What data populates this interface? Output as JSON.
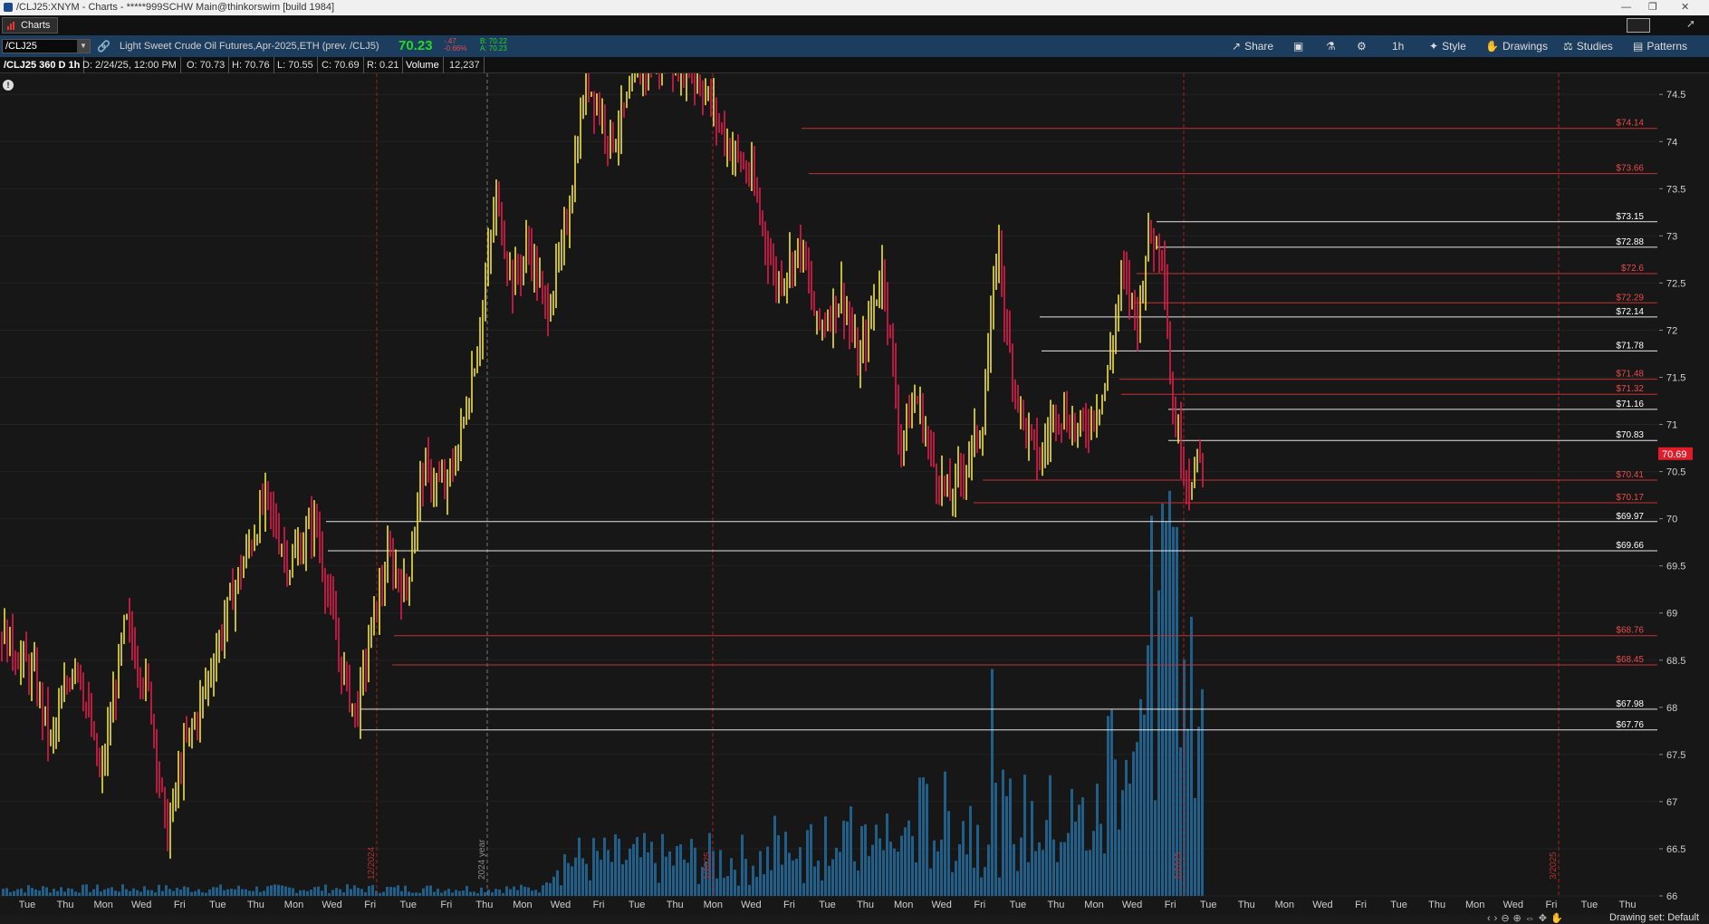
{
  "window": {
    "title": "/CLJ25:XNYM - Charts - *****999SCHW Main@thinkorswim [build 1984]"
  },
  "tab": {
    "label": "Charts"
  },
  "symbol": {
    "value": "/CLJ25",
    "description": "Light Sweet Crude Oil Futures,Apr-2025,ETH (prev. /CLJ5)",
    "last": "70.23",
    "change": "-.47",
    "change_pct": "-0.66%",
    "bid": "B: 70.22",
    "ask": "A: 70.23"
  },
  "toolbar": {
    "share": "Share",
    "timeframe": "1h",
    "style": "Style",
    "drawings": "Drawings",
    "studies": "Studies",
    "patterns": "Patterns"
  },
  "infobar": {
    "aggregation": "/CLJ25 360 D 1h",
    "date": "D: 2/24/25, 12:00 PM",
    "open": "O: 70.73",
    "high": "H: 70.76",
    "low": "L: 70.55",
    "close": "C: 70.69",
    "range": "R: 0.21",
    "volume_label": "Volume",
    "volume_value": "12,237"
  },
  "footer": {
    "drawing_set": "Drawing set: Default"
  },
  "chart_data": {
    "type": "ohlc",
    "current_price": "70.69",
    "y_axis_ticks": [
      "74.5",
      "74",
      "73.5",
      "73",
      "72.5",
      "72",
      "71.5",
      "71",
      "70.5",
      "70",
      "69.5",
      "69",
      "68.5",
      "68",
      "67.5",
      "67",
      "66.5",
      "66"
    ],
    "ylim": [
      66,
      74.8
    ],
    "x_axis_labels": [
      "Tue",
      "Thu",
      "Mon",
      "Wed",
      "Fri",
      "Tue",
      "Thu",
      "Mon",
      "Wed",
      "Fri",
      "Tue",
      "Fri",
      "Thu",
      "Mon",
      "Wed",
      "Fri",
      "Tue",
      "Thu",
      "Mon",
      "Wed",
      "Fri",
      "Tue",
      "Thu",
      "Mon",
      "Wed",
      "Fri",
      "Tue",
      "Thu",
      "Mon",
      "Wed",
      "Fri",
      "Tue",
      "Thu",
      "Mon",
      "Wed",
      "Fri",
      "Tue",
      "Thu",
      "Mon",
      "Wed",
      "Fri",
      "Tue",
      "Thu"
    ],
    "period_markers": [
      "12/2024",
      "2024 year",
      "1/2025",
      "2/2025",
      "3/2025"
    ],
    "levels": [
      {
        "label": "$74.14",
        "value": 74.14,
        "color": "#e84a4a"
      },
      {
        "label": "$73.66",
        "value": 73.66,
        "color": "#e84a4a"
      },
      {
        "label": "$73.15",
        "value": 73.15,
        "color": "#ffffff"
      },
      {
        "label": "$72.88",
        "value": 72.88,
        "color": "#ffffff"
      },
      {
        "label": "$72.6",
        "value": 72.6,
        "color": "#e84a4a"
      },
      {
        "label": "$72.29",
        "value": 72.29,
        "color": "#e84a4a"
      },
      {
        "label": "$72.14",
        "value": 72.14,
        "color": "#ffffff"
      },
      {
        "label": "$71.78",
        "value": 71.78,
        "color": "#ffffff"
      },
      {
        "label": "$71.48",
        "value": 71.48,
        "color": "#e84a4a"
      },
      {
        "label": "$71.32",
        "value": 71.32,
        "color": "#e84a4a"
      },
      {
        "label": "$71.16",
        "value": 71.16,
        "color": "#ffffff"
      },
      {
        "label": "$70.83",
        "value": 70.83,
        "color": "#ffffff"
      },
      {
        "label": "$70.41",
        "value": 70.41,
        "color": "#e84a4a"
      },
      {
        "label": "$70.17",
        "value": 70.17,
        "color": "#e84a4a"
      },
      {
        "label": "$69.97",
        "value": 69.97,
        "color": "#ffffff"
      },
      {
        "label": "$69.66",
        "value": 69.66,
        "color": "#ffffff"
      },
      {
        "label": "$68.76",
        "value": 68.76,
        "color": "#e84a4a"
      },
      {
        "label": "$68.45",
        "value": 68.45,
        "color": "#e84a4a"
      },
      {
        "label": "$67.98",
        "value": 67.98,
        "color": "#ffffff"
      },
      {
        "label": "$67.76",
        "value": 67.76,
        "color": "#ffffff"
      }
    ],
    "price_path": [
      [
        0,
        68.8
      ],
      [
        0.02,
        68.3
      ],
      [
        0.03,
        67.6
      ],
      [
        0.045,
        68.6
      ],
      [
        0.06,
        67.2
      ],
      [
        0.075,
        68.9
      ],
      [
        0.09,
        68.1
      ],
      [
        0.1,
        66.6
      ],
      [
        0.11,
        67.5
      ],
      [
        0.12,
        68.0
      ],
      [
        0.14,
        69.2
      ],
      [
        0.16,
        70.2
      ],
      [
        0.175,
        69.5
      ],
      [
        0.19,
        70.0
      ],
      [
        0.205,
        68.5
      ],
      [
        0.215,
        67.9
      ],
      [
        0.225,
        68.9
      ],
      [
        0.235,
        69.6
      ],
      [
        0.245,
        69.2
      ],
      [
        0.255,
        70.5
      ],
      [
        0.27,
        70.3
      ],
      [
        0.28,
        71.0
      ],
      [
        0.29,
        72.0
      ],
      [
        0.3,
        73.4
      ],
      [
        0.31,
        72.5
      ],
      [
        0.32,
        72.9
      ],
      [
        0.33,
        72.2
      ],
      [
        0.34,
        72.8
      ],
      [
        0.355,
        74.7
      ],
      [
        0.37,
        74.0
      ],
      [
        0.39,
        74.8
      ],
      [
        0.41,
        74.9
      ],
      [
        0.425,
        74.6
      ],
      [
        0.44,
        74.0
      ],
      [
        0.455,
        73.6
      ],
      [
        0.47,
        72.5
      ],
      [
        0.485,
        72.9
      ],
      [
        0.495,
        72.0
      ],
      [
        0.51,
        72.4
      ],
      [
        0.52,
        71.6
      ],
      [
        0.535,
        72.7
      ],
      [
        0.545,
        70.8
      ],
      [
        0.555,
        71.3
      ],
      [
        0.565,
        70.6
      ],
      [
        0.575,
        70.2
      ],
      [
        0.585,
        70.6
      ],
      [
        0.595,
        71.0
      ],
      [
        0.605,
        73.0
      ],
      [
        0.61,
        71.9
      ],
      [
        0.62,
        71.0
      ],
      [
        0.63,
        70.6
      ],
      [
        0.64,
        71.2
      ],
      [
        0.655,
        70.9
      ],
      [
        0.67,
        71.4
      ],
      [
        0.68,
        72.6
      ],
      [
        0.69,
        72.1
      ],
      [
        0.695,
        73.0
      ],
      [
        0.705,
        72.9
      ],
      [
        0.71,
        71.2
      ],
      [
        0.72,
        70.4
      ],
      [
        0.73,
        70.7
      ]
    ]
  }
}
